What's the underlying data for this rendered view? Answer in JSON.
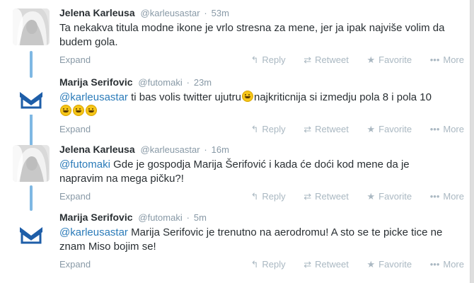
{
  "tweets": [
    {
      "name": "Jelena Karleusa",
      "handle": "@karleusastar",
      "time": "53m",
      "text_plain": "Ta nekakva titula modne ikone je vrlo stresna za mene, jer ja ipak najviše volim da budem gola.",
      "avatar_icon": "woman-photo"
    },
    {
      "name": "Marija Serifovic",
      "handle": "@futomaki",
      "time": "23m",
      "mention": "@karleusastar",
      "text_a": " ti bas volis twitter ujutru",
      "text_b": "najkriticnija si izmedju pola 8 i pola 10",
      "avatar_icon": "chevron-logo"
    },
    {
      "name": "Jelena Karleusa",
      "handle": "@karleusastar",
      "time": "16m",
      "mention": "@futomaki",
      "text_a": " Gde je gospodja Marija Šerifović i kada će doći kod mene da je napravim na mega pičku?!",
      "avatar_icon": "woman-photo"
    },
    {
      "name": "Marija Serifovic",
      "handle": "@futomaki",
      "time": "5m",
      "mention": "@karleusastar",
      "text_a": " Marija Serifovic je trenutno na aerodromu! A sto se te picke tice ne znam Miso bojim se!",
      "avatar_icon": "chevron-logo"
    }
  ],
  "labels": {
    "expand": "Expand",
    "reply": "Reply",
    "retweet": "Retweet",
    "favorite": "Favorite",
    "more": "More",
    "dot": "·"
  },
  "icons": {
    "reply": "reply-arrow-icon",
    "retweet": "retweet-icon",
    "favorite": "star-icon",
    "more": "more-dots-icon",
    "emoji": "grinning-emoji-icon"
  },
  "colors": {
    "mention": "#2b7bb9",
    "connector": "#7fb8e3",
    "chevron": "#1e5ea8"
  }
}
